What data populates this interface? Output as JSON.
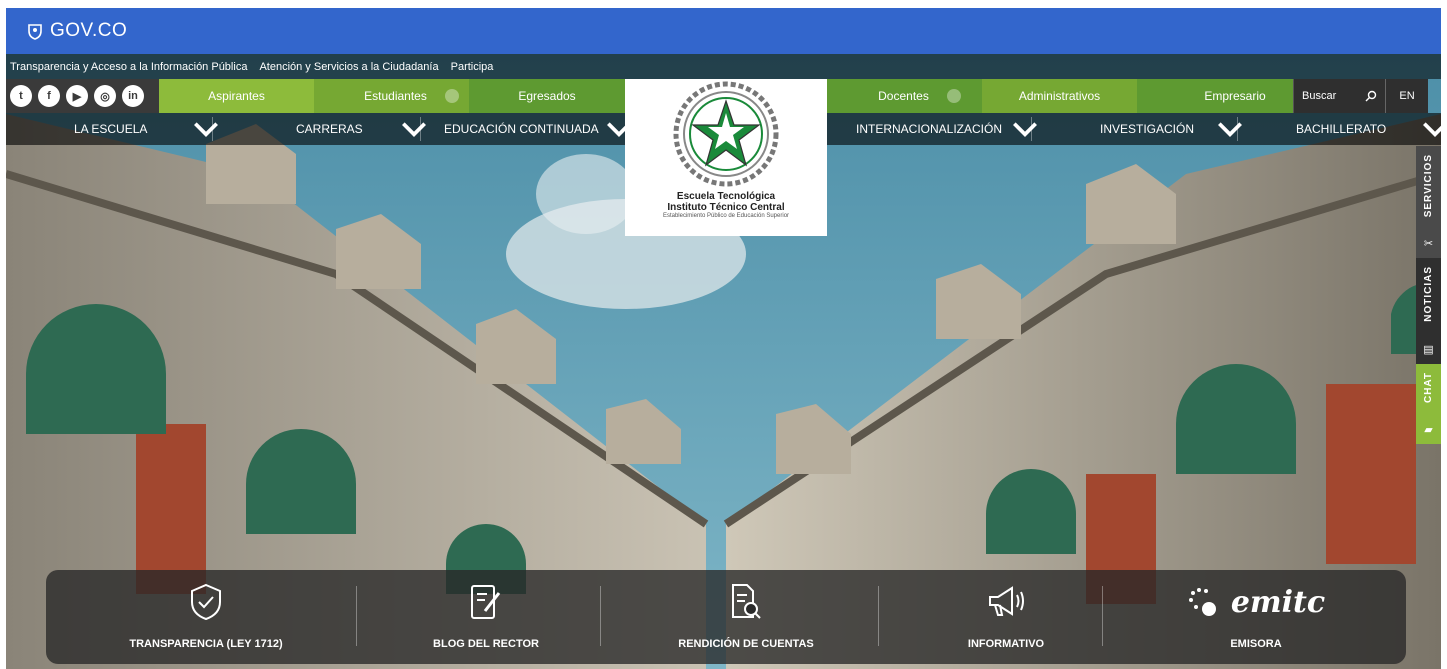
{
  "gov": {
    "label": "GOV.CO"
  },
  "transparency_bar": {
    "links": [
      "Transparencia y Acceso a la Información Pública",
      "Atención y Servicios a la Ciudadanía",
      "Participa"
    ]
  },
  "social": {
    "icons": [
      "twitter-icon",
      "facebook-icon",
      "youtube-icon",
      "instagram-icon",
      "linkedin-icon"
    ],
    "glyphs": [
      "t",
      "f",
      "▶",
      "◎",
      "in"
    ]
  },
  "audience": {
    "items": [
      "Aspirantes",
      "Estudiantes",
      "Egresados",
      "Docentes",
      "Administrativos",
      "Empresario"
    ],
    "colors": [
      "#8dbb3b",
      "#76a833",
      "#5e9a31",
      "#5e9a31",
      "#76a833",
      "#5e9a31"
    ]
  },
  "search": {
    "label": "Buscar"
  },
  "lang": {
    "label": "EN"
  },
  "nav": {
    "items": [
      "LA ESCUELA",
      "CARRERAS",
      "EDUCACIÓN CONTINUADA",
      "INTERNACIONALIZACIÓN",
      "INVESTIGACIÓN",
      "BACHILLERATO"
    ]
  },
  "logo": {
    "line1": "Escuela Tecnológica",
    "line2": "Instituto Técnico Central",
    "line3": "Establecimiento Público de Educación Superior"
  },
  "side_tabs": {
    "servicios": "SERVICIOS",
    "noticias": "NOTICIAS",
    "chat": "CHAT"
  },
  "quick_links": {
    "items": [
      "TRANSPARENCIA (LEY 1712)",
      "BLOG DEL RECTOR",
      "RENDICIÓN DE CUENTAS",
      "INFORMATIVO",
      "EMISORA"
    ],
    "emisora_logo": "emitc"
  },
  "colors": {
    "gov_blue": "#3366cc",
    "chat_green": "#8dbb3b",
    "accent_green": "#1a8a3a"
  }
}
